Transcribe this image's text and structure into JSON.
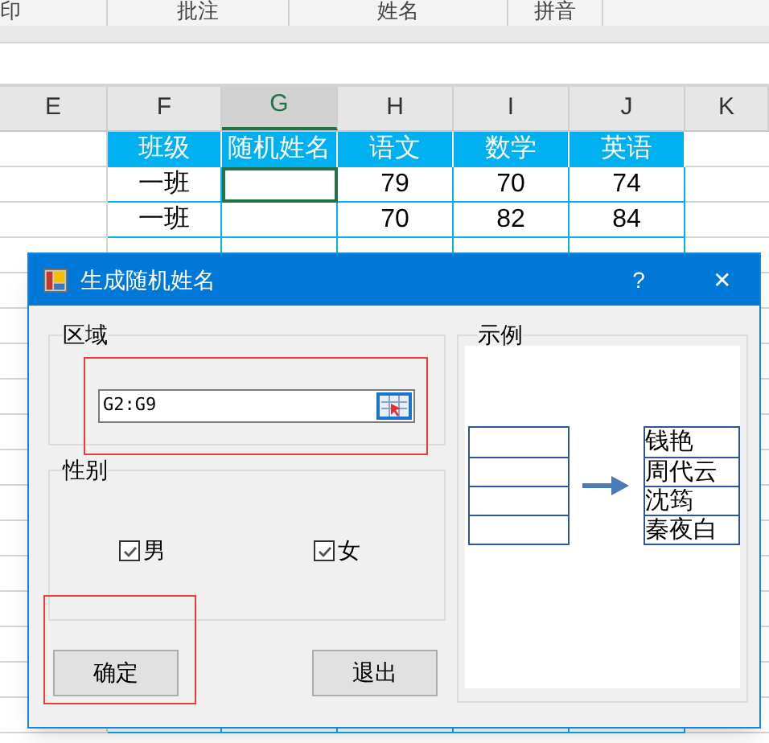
{
  "ribbon": {
    "labels": [
      "印",
      "批注",
      "姓名",
      "拼音"
    ]
  },
  "columns": [
    {
      "letter": "E",
      "selected": false
    },
    {
      "letter": "F",
      "selected": false
    },
    {
      "letter": "G",
      "selected": true
    },
    {
      "letter": "H",
      "selected": false
    },
    {
      "letter": "I",
      "selected": false
    },
    {
      "letter": "J",
      "selected": false
    },
    {
      "letter": "K",
      "selected": false
    }
  ],
  "table": {
    "headers": [
      "班级",
      "随机姓名",
      "语文",
      "数学",
      "英语"
    ],
    "rows": [
      {
        "class": "一班",
        "name_cell_selected": true,
        "scores": [
          "79",
          "70",
          "74"
        ]
      },
      {
        "class": "一班",
        "name_cell_selected": false,
        "scores": [
          "70",
          "82",
          "84"
        ]
      }
    ]
  },
  "dialog": {
    "title": "生成随机姓名",
    "help": "?",
    "close": "✕",
    "region": {
      "label": "区域",
      "value": "G2:G9"
    },
    "gender": {
      "label": "性别",
      "options": [
        {
          "label": "男",
          "checked": true
        },
        {
          "label": "女",
          "checked": true
        }
      ]
    },
    "buttons": [
      "确定",
      "退出"
    ],
    "example": {
      "label": "示例",
      "names": [
        "钱艳",
        "周代云",
        "沈筠",
        "秦夜白"
      ]
    }
  }
}
